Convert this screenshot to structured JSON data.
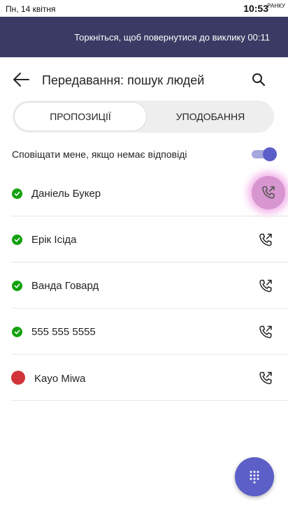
{
  "status_bar": {
    "date": "Пн, 14 квітня",
    "time": "10:53",
    "ampm": "РАНКУ"
  },
  "call_banner": {
    "text": "Торкніться, щоб повернутися до виклику 00:11"
  },
  "header": {
    "title": "Передавання: пошук людей",
    "back_icon": "arrow-left-icon",
    "search_icon": "search-icon"
  },
  "tabs": [
    {
      "label": "ПРОПОЗИЦІЇ",
      "selected": true
    },
    {
      "label": "УПОДОБАННЯ",
      "selected": false
    }
  ],
  "notify": {
    "label": "Сповіщати мене, якщо немає відповіді",
    "enabled": true
  },
  "contacts": [
    {
      "name": "Даніель Букер",
      "presence": "available"
    },
    {
      "name": "Ерік Ісіда",
      "presence": "available"
    },
    {
      "name": "Ванда Говард",
      "presence": "available"
    },
    {
      "name": "555 555 5555",
      "presence": "available"
    },
    {
      "name": "Kayo Miwa",
      "presence": "busy"
    }
  ],
  "colors": {
    "banner": "#3a3a64",
    "accent": "#5b5fc7",
    "available": "#13a10e",
    "busy": "#d13438",
    "pressed_highlight": "#d896d0"
  },
  "fab": {
    "icon": "dialpad-icon"
  }
}
